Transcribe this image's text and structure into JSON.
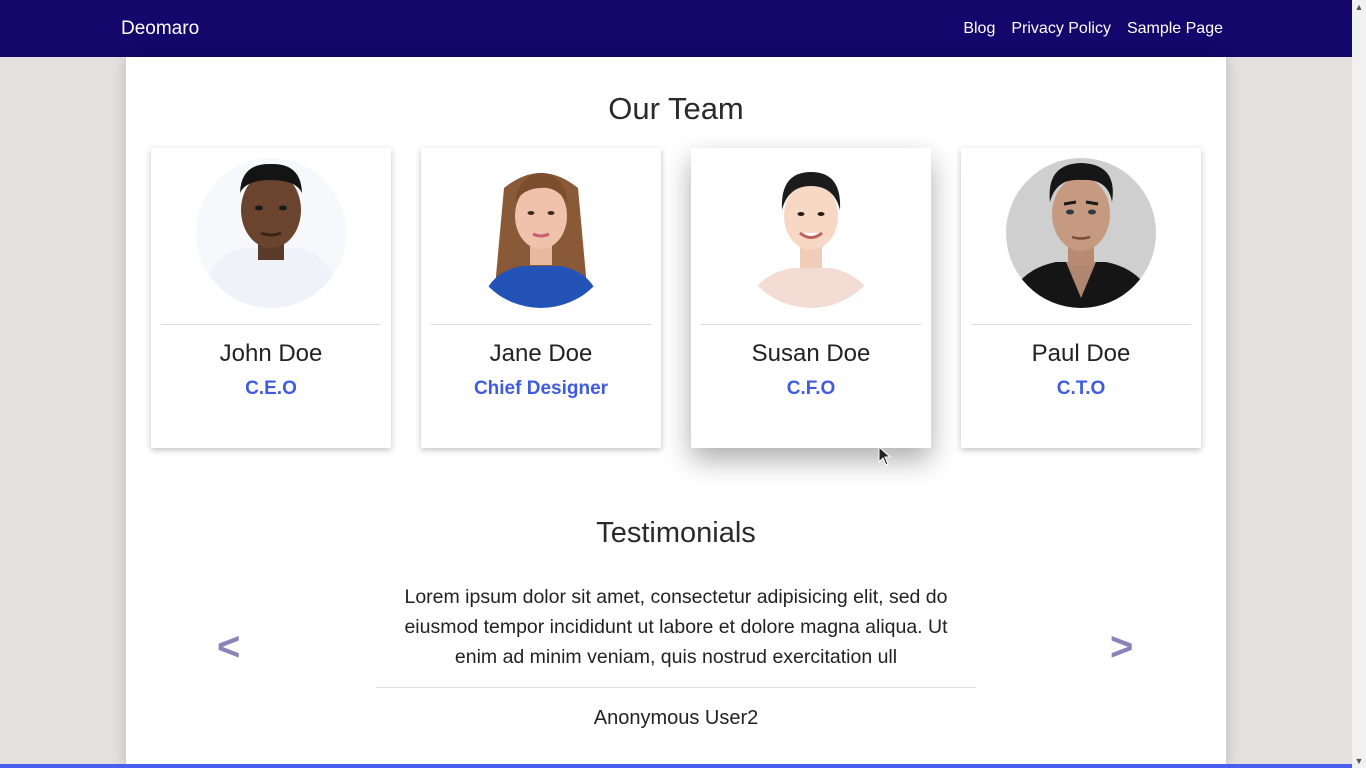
{
  "navbar": {
    "brand": "Deomaro",
    "links": [
      "Blog",
      "Privacy Policy",
      "Sample Page"
    ]
  },
  "team": {
    "title": "Our Team",
    "members": [
      {
        "name": "John Doe",
        "role": "C.E.O"
      },
      {
        "name": "Jane Doe",
        "role": "Chief Designer"
      },
      {
        "name": "Susan Doe",
        "role": "C.F.O"
      },
      {
        "name": "Paul Doe",
        "role": "C.T.O"
      }
    ]
  },
  "testimonials": {
    "title": "Testimonials",
    "prev_label": "<",
    "next_label": ">",
    "quote": "Lorem ipsum dolor sit amet, consectetur adipisicing elit, sed do eiusmod tempor incididunt ut labore et dolore magna aliqua. Ut enim ad minim veniam, quis nostrud exercitation ull",
    "author": "Anonymous User2"
  },
  "colors": {
    "navbar": "#14066a",
    "role_text": "#3f5be0",
    "arrows": "#8b83b8",
    "page_bg": "#e2e1e0",
    "accent_bar": "#4a5ff0"
  }
}
